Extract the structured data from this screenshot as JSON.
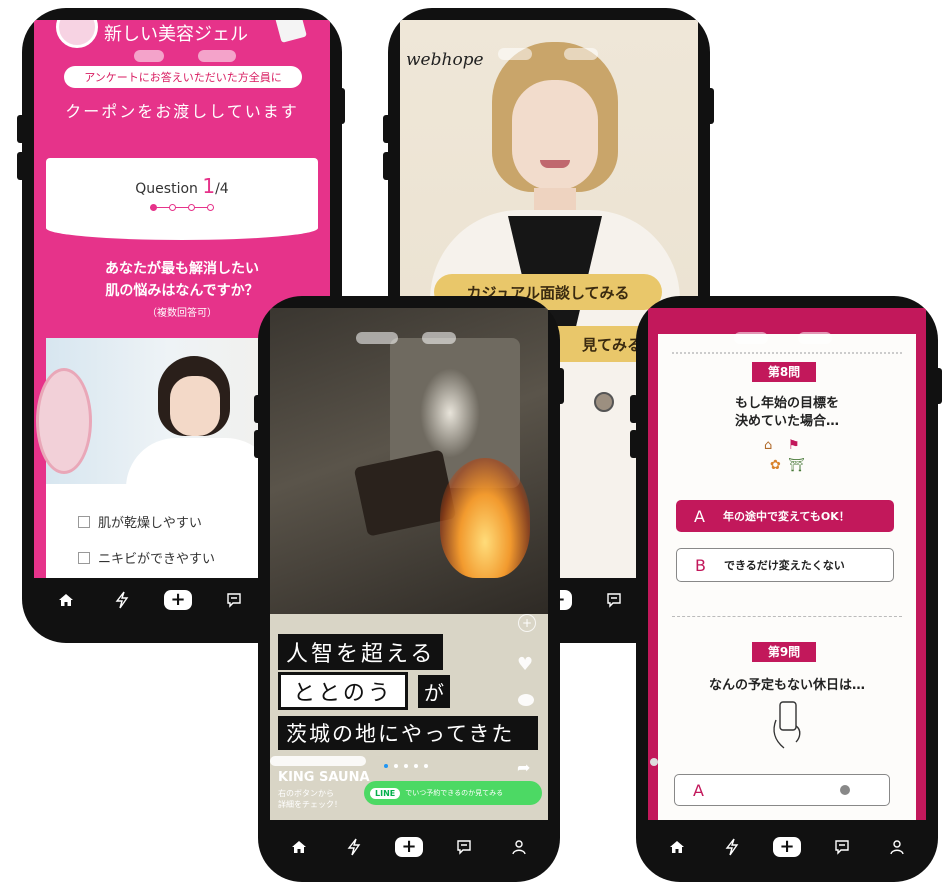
{
  "phone1": {
    "banner_title": "新しい美容ジェル",
    "coupon_pill": "アンケートにお答えいただいた方全員に",
    "coupon_text": "クーポンをお渡ししています",
    "question_label": "Question",
    "question_current": "1",
    "question_total": "/4",
    "question_line1": "あなたが最も解消したい",
    "question_line2": "肌の悩みはなんですか？",
    "question_note": "（複数回答可）",
    "options": [
      "肌が乾燥しやすい",
      "ニキビができやすい"
    ],
    "accent": "#e6338a"
  },
  "phone2": {
    "logo": "webhope",
    "btn1": "カジュアル面談してみる",
    "btn2": "見てみる",
    "accent": "#e9c76a"
  },
  "phone3": {
    "line1": "人智を超える",
    "line2_box": "ととのう",
    "line2_tail": "が",
    "line3": "茨城の地にやってきた",
    "brand": "KING SAUNA",
    "caption_line1": "右のボタンから",
    "caption_line2": "詳細をチェック！",
    "line_badge": "LINE",
    "line_text": "でいつ予約できるのか見てみる",
    "line_color": "#4cd964"
  },
  "phone4": {
    "q8_badge": "第8問",
    "q8_line1": "もし年始の目標を",
    "q8_line2": "決めていた場合…",
    "q8_optA_letter": "A",
    "q8_optA_text": "年の途中で変えてもOK！",
    "q8_optB_letter": "B",
    "q8_optB_text": "できるだけ変えたくない",
    "q9_badge": "第9問",
    "q9_text": "なんの予定もない休日は…",
    "q9_optA_letter": "A",
    "accent": "#c2185b"
  }
}
